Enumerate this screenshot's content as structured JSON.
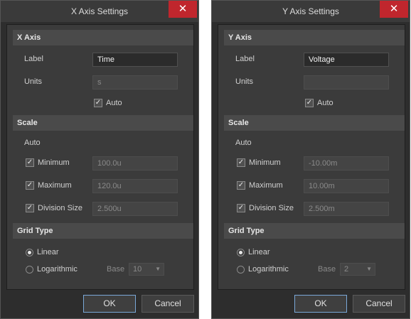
{
  "dialogs": [
    {
      "title": "X Axis Settings",
      "close_glyph": "✕",
      "axis_section": "X Axis",
      "label_label": "Label",
      "label_value": "Time",
      "units_label": "Units",
      "units_value": "s",
      "auto_label": "Auto",
      "auto_checked": true,
      "scale_section": "Scale",
      "scale_auto": "Auto",
      "minimum_label": "Minimum",
      "minimum_value": "100.0u",
      "minimum_checked": true,
      "maximum_label": "Maximum",
      "maximum_value": "120.0u",
      "maximum_checked": true,
      "division_label": "Division Size",
      "division_value": "2.500u",
      "division_checked": true,
      "grid_section": "Grid Type",
      "linear_label": "Linear",
      "log_label": "Logarithmic",
      "base_label": "Base",
      "base_value": "10",
      "ok_label": "OK",
      "cancel_label": "Cancel"
    },
    {
      "title": "Y Axis Settings",
      "close_glyph": "✕",
      "axis_section": "Y Axis",
      "label_label": "Label",
      "label_value": "Voltage",
      "units_label": "Units",
      "units_value": "",
      "auto_label": "Auto",
      "auto_checked": true,
      "scale_section": "Scale",
      "scale_auto": "Auto",
      "minimum_label": "Minimum",
      "minimum_value": "-10.00m",
      "minimum_checked": true,
      "maximum_label": "Maximum",
      "maximum_value": "10.00m",
      "maximum_checked": true,
      "division_label": "Division Size",
      "division_value": "2.500m",
      "division_checked": true,
      "grid_section": "Grid Type",
      "linear_label": "Linear",
      "log_label": "Logarithmic",
      "base_label": "Base",
      "base_value": "2",
      "ok_label": "OK",
      "cancel_label": "Cancel"
    }
  ],
  "colors": {
    "dialog_bg": "#2d2d2d",
    "panel_bg": "#3b3b3b",
    "section_bg": "#4a4a4a",
    "close_red": "#c0262d",
    "ok_border": "#7aa8d8"
  },
  "icons": {
    "close": "close-icon",
    "checkbox": "checkmark-icon",
    "dropdown": "chevron-down-icon"
  }
}
